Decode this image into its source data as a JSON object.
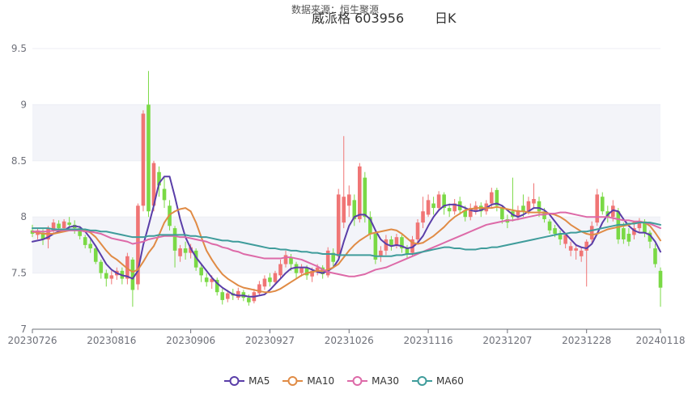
{
  "header": {
    "source": "数据来源：恒生聚源",
    "period": "日K"
  },
  "chart_data": {
    "type": "candlestick",
    "title": "威派格 603956",
    "ylim": [
      7,
      9.5
    ],
    "yticks": [
      7,
      7.5,
      8,
      8.5,
      9,
      9.5
    ],
    "xticks": [
      {
        "label": "20230726",
        "index": 0
      },
      {
        "label": "20230816",
        "index": 15
      },
      {
        "label": "20230906",
        "index": 30
      },
      {
        "label": "20230927",
        "index": 45
      },
      {
        "label": "20231026",
        "index": 60
      },
      {
        "label": "20231116",
        "index": 75
      },
      {
        "label": "20231207",
        "index": 90
      },
      {
        "label": "20231228",
        "index": 105
      },
      {
        "label": "20240118",
        "index": 119
      }
    ],
    "up_color": "#f07575",
    "down_color": "#7ad945",
    "open": [
      7.88,
      7.84,
      7.86,
      7.8,
      7.88,
      7.94,
      7.9,
      7.95,
      7.93,
      7.9,
      7.82,
      7.76,
      7.72,
      7.6,
      7.5,
      7.45,
      7.48,
      7.52,
      7.45,
      7.62,
      7.4,
      8.1,
      9.0,
      8.1,
      8.4,
      8.25,
      8.1,
      7.9,
      7.65,
      7.72,
      7.68,
      7.7,
      7.55,
      7.46,
      7.42,
      7.44,
      7.33,
      7.27,
      7.32,
      7.28,
      7.33,
      7.28,
      7.25,
      7.32,
      7.38,
      7.46,
      7.42,
      7.48,
      7.58,
      7.64,
      7.58,
      7.5,
      7.55,
      7.47,
      7.52,
      7.55,
      7.48,
      7.68,
      7.65,
      7.95,
      8.1,
      8.15,
      7.98,
      8.35,
      8.0,
      7.85,
      7.65,
      7.7,
      7.8,
      7.75,
      7.82,
      7.72,
      7.68,
      7.8,
      7.95,
      8.02,
      8.12,
      8.08,
      8.2,
      8.08,
      8.05,
      8.14,
      8.06,
      8.0,
      8.06,
      8.1,
      8.05,
      8.12,
      8.24,
      8.08,
      7.98,
      8.05,
      8.0,
      8.1,
      8.05,
      8.12,
      8.14,
      8.05,
      7.96,
      7.9,
      7.85,
      7.76,
      7.7,
      7.7,
      7.65,
      7.7,
      7.8,
      7.95,
      8.18,
      8.05,
      8.0,
      8.05,
      7.9,
      7.85,
      7.84,
      7.9,
      7.96,
      7.86,
      7.72,
      7.52
    ],
    "close": [
      7.85,
      7.88,
      7.8,
      7.9,
      7.95,
      7.9,
      7.96,
      7.93,
      7.9,
      7.83,
      7.75,
      7.72,
      7.6,
      7.5,
      7.45,
      7.48,
      7.52,
      7.45,
      7.65,
      7.35,
      8.1,
      8.92,
      8.05,
      8.48,
      8.28,
      8.15,
      7.92,
      7.7,
      7.72,
      7.68,
      7.73,
      7.55,
      7.48,
      7.42,
      7.45,
      7.33,
      7.26,
      7.32,
      7.3,
      7.34,
      7.28,
      7.24,
      7.33,
      7.4,
      7.45,
      7.42,
      7.5,
      7.58,
      7.66,
      7.58,
      7.5,
      7.55,
      7.48,
      7.52,
      7.55,
      7.49,
      7.7,
      7.6,
      8.2,
      8.18,
      8.2,
      7.98,
      8.45,
      8.0,
      7.85,
      7.62,
      7.7,
      7.8,
      7.75,
      7.82,
      7.72,
      7.67,
      7.8,
      7.95,
      8.05,
      8.15,
      8.08,
      8.2,
      8.08,
      8.05,
      8.12,
      8.06,
      8.0,
      8.08,
      8.1,
      8.05,
      8.12,
      8.22,
      8.1,
      7.98,
      7.95,
      8.0,
      8.06,
      8.05,
      8.14,
      8.16,
      8.05,
      7.98,
      7.88,
      7.85,
      7.8,
      7.84,
      7.74,
      7.72,
      7.7,
      7.78,
      7.92,
      8.2,
      8.05,
      8.0,
      8.1,
      7.8,
      7.8,
      7.78,
      7.9,
      7.96,
      7.86,
      7.78,
      7.58,
      7.37
    ],
    "low": [
      7.82,
      7.8,
      7.75,
      7.72,
      7.85,
      7.86,
      7.88,
      7.88,
      7.85,
      7.8,
      7.72,
      7.68,
      7.58,
      7.45,
      7.38,
      7.4,
      7.44,
      7.4,
      7.4,
      7.2,
      7.35,
      8.05,
      8.0,
      8.05,
      8.18,
      8.08,
      7.88,
      7.55,
      7.6,
      7.62,
      7.63,
      7.52,
      7.42,
      7.38,
      7.36,
      7.3,
      7.22,
      7.24,
      7.26,
      7.26,
      7.25,
      7.21,
      7.23,
      7.3,
      7.35,
      7.38,
      7.4,
      7.45,
      7.55,
      7.52,
      7.45,
      7.47,
      7.44,
      7.42,
      7.48,
      7.45,
      7.46,
      7.55,
      7.62,
      7.9,
      8.0,
      7.92,
      7.95,
      7.95,
      7.8,
      7.58,
      7.6,
      7.66,
      7.7,
      7.72,
      7.68,
      7.63,
      7.65,
      7.78,
      7.9,
      8.0,
      8.02,
      8.05,
      8.02,
      8.0,
      8.02,
      8.02,
      7.96,
      7.97,
      8.02,
      8.0,
      8.02,
      8.08,
      8.05,
      7.94,
      7.9,
      7.96,
      7.97,
      8.0,
      8.02,
      8.08,
      8.0,
      7.95,
      7.85,
      7.82,
      7.75,
      7.72,
      7.65,
      7.62,
      7.6,
      7.38,
      7.76,
      7.92,
      8.02,
      7.95,
      7.96,
      7.76,
      7.76,
      7.74,
      7.8,
      7.86,
      7.82,
      7.72,
      7.55,
      7.2
    ],
    "high": [
      7.93,
      7.9,
      7.89,
      7.92,
      7.98,
      7.97,
      7.98,
      8.0,
      7.97,
      7.92,
      7.84,
      7.8,
      7.75,
      7.62,
      7.53,
      7.52,
      7.55,
      7.55,
      7.68,
      7.64,
      8.12,
      8.95,
      9.3,
      8.5,
      8.45,
      8.35,
      8.15,
      7.92,
      7.75,
      7.78,
      7.76,
      7.72,
      7.58,
      7.5,
      7.48,
      7.46,
      7.36,
      7.35,
      7.36,
      7.37,
      7.35,
      7.31,
      7.36,
      7.43,
      7.48,
      7.5,
      7.52,
      7.62,
      7.7,
      7.67,
      7.6,
      7.58,
      7.57,
      7.55,
      7.58,
      7.57,
      7.73,
      7.72,
      8.25,
      8.72,
      8.28,
      8.2,
      8.48,
      8.4,
      8.05,
      7.88,
      7.74,
      7.84,
      7.83,
      7.85,
      7.84,
      7.75,
      7.83,
      7.98,
      8.18,
      8.2,
      8.18,
      8.23,
      8.22,
      8.12,
      8.16,
      8.18,
      8.1,
      8.12,
      8.14,
      8.13,
      8.15,
      8.26,
      8.26,
      8.1,
      8.02,
      8.35,
      8.1,
      8.2,
      8.18,
      8.3,
      8.18,
      8.08,
      7.98,
      7.93,
      7.88,
      7.86,
      7.78,
      7.76,
      7.73,
      7.8,
      7.96,
      8.25,
      8.22,
      8.1,
      8.15,
      8.08,
      7.95,
      7.9,
      7.94,
      7.99,
      7.98,
      7.88,
      7.76,
      7.55
    ],
    "series": [
      {
        "name": "MA5",
        "color": "#5a3ea8",
        "values": [
          7.78,
          7.79,
          7.8,
          7.82,
          7.85,
          7.87,
          7.88,
          7.91,
          7.92,
          7.91,
          7.87,
          7.81,
          7.74,
          7.66,
          7.58,
          7.53,
          7.5,
          7.48,
          7.47,
          7.45,
          7.52,
          7.75,
          7.92,
          8.1,
          8.3,
          8.36,
          8.36,
          8.18,
          7.98,
          7.82,
          7.72,
          7.64,
          7.58,
          7.52,
          7.46,
          7.41,
          7.37,
          7.34,
          7.31,
          7.3,
          7.3,
          7.29,
          7.29,
          7.3,
          7.31,
          7.35,
          7.4,
          7.45,
          7.5,
          7.54,
          7.55,
          7.55,
          7.55,
          7.53,
          7.51,
          7.5,
          7.52,
          7.55,
          7.62,
          7.78,
          7.92,
          8.0,
          8.02,
          8.02,
          7.98,
          7.88,
          7.8,
          7.76,
          7.74,
          7.75,
          7.74,
          7.72,
          7.73,
          7.77,
          7.83,
          7.92,
          8.0,
          8.06,
          8.1,
          8.11,
          8.11,
          8.1,
          8.08,
          8.06,
          8.05,
          8.06,
          8.08,
          8.11,
          8.12,
          8.1,
          8.06,
          8.02,
          8.0,
          8.02,
          8.05,
          8.08,
          8.08,
          8.06,
          8.02,
          7.96,
          7.9,
          7.85,
          7.8,
          7.75,
          7.73,
          7.72,
          7.76,
          7.85,
          7.95,
          8.02,
          8.06,
          8.05,
          7.98,
          7.92,
          7.88,
          7.86,
          7.86,
          7.84,
          7.78,
          7.69
        ]
      },
      {
        "name": "MA10",
        "color": "#e08b45",
        "values": [
          7.87,
          7.86,
          7.85,
          7.85,
          7.85,
          7.86,
          7.87,
          7.88,
          7.89,
          7.89,
          7.88,
          7.86,
          7.82,
          7.76,
          7.7,
          7.65,
          7.62,
          7.58,
          7.54,
          7.51,
          7.53,
          7.6,
          7.68,
          7.74,
          7.84,
          7.95,
          8.02,
          8.05,
          8.07,
          8.08,
          8.05,
          7.95,
          7.82,
          7.7,
          7.62,
          7.55,
          7.49,
          7.45,
          7.42,
          7.39,
          7.37,
          7.36,
          7.35,
          7.34,
          7.33,
          7.33,
          7.34,
          7.36,
          7.39,
          7.42,
          7.45,
          7.48,
          7.5,
          7.51,
          7.52,
          7.52,
          7.53,
          7.55,
          7.58,
          7.64,
          7.7,
          7.75,
          7.79,
          7.82,
          7.85,
          7.86,
          7.87,
          7.88,
          7.89,
          7.88,
          7.85,
          7.81,
          7.77,
          7.76,
          7.77,
          7.8,
          7.83,
          7.87,
          7.91,
          7.96,
          8.0,
          8.03,
          8.06,
          8.07,
          8.08,
          8.08,
          8.08,
          8.08,
          8.09,
          8.08,
          8.07,
          8.06,
          8.05,
          8.05,
          8.04,
          8.04,
          8.04,
          8.04,
          8.03,
          8.02,
          8.0,
          7.97,
          7.93,
          7.9,
          7.87,
          7.85,
          7.84,
          7.85,
          7.87,
          7.89,
          7.9,
          7.91,
          7.92,
          7.93,
          7.95,
          7.96,
          7.95,
          7.92,
          7.86,
          7.79
        ]
      },
      {
        "name": "MA30",
        "color": "#dd6aa8",
        "values": [
          7.87,
          7.87,
          7.87,
          7.87,
          7.88,
          7.88,
          7.88,
          7.88,
          7.88,
          7.88,
          7.87,
          7.87,
          7.86,
          7.85,
          7.83,
          7.81,
          7.8,
          7.79,
          7.78,
          7.76,
          7.77,
          7.78,
          7.8,
          7.81,
          7.82,
          7.83,
          7.83,
          7.83,
          7.82,
          7.82,
          7.81,
          7.8,
          7.79,
          7.78,
          7.76,
          7.75,
          7.73,
          7.72,
          7.7,
          7.69,
          7.67,
          7.66,
          7.65,
          7.64,
          7.63,
          7.63,
          7.63,
          7.63,
          7.64,
          7.64,
          7.63,
          7.62,
          7.6,
          7.58,
          7.56,
          7.53,
          7.51,
          7.5,
          7.49,
          7.48,
          7.47,
          7.47,
          7.48,
          7.49,
          7.51,
          7.53,
          7.54,
          7.55,
          7.57,
          7.59,
          7.61,
          7.63,
          7.65,
          7.67,
          7.69,
          7.71,
          7.73,
          7.75,
          7.77,
          7.79,
          7.81,
          7.83,
          7.85,
          7.87,
          7.89,
          7.91,
          7.93,
          7.94,
          7.95,
          7.96,
          7.97,
          7.97,
          7.98,
          7.99,
          8.0,
          8.01,
          8.02,
          8.02,
          8.03,
          8.03,
          8.04,
          8.04,
          8.03,
          8.02,
          8.01,
          8.0,
          8.0,
          8.0,
          8.0,
          8.0,
          7.99,
          7.98,
          7.97,
          7.97,
          7.96,
          7.96,
          7.95,
          7.94,
          7.92,
          7.9
        ]
      },
      {
        "name": "MA60",
        "color": "#3f9c9b",
        "values": [
          7.9,
          7.9,
          7.9,
          7.9,
          7.89,
          7.89,
          7.89,
          7.89,
          7.89,
          7.89,
          7.89,
          7.88,
          7.88,
          7.87,
          7.87,
          7.86,
          7.85,
          7.84,
          7.83,
          7.82,
          7.82,
          7.82,
          7.83,
          7.83,
          7.84,
          7.84,
          7.84,
          7.84,
          7.84,
          7.84,
          7.83,
          7.83,
          7.82,
          7.82,
          7.81,
          7.8,
          7.79,
          7.79,
          7.78,
          7.78,
          7.77,
          7.76,
          7.75,
          7.74,
          7.73,
          7.72,
          7.72,
          7.71,
          7.71,
          7.7,
          7.7,
          7.69,
          7.69,
          7.68,
          7.68,
          7.67,
          7.67,
          7.67,
          7.66,
          7.66,
          7.66,
          7.66,
          7.66,
          7.66,
          7.66,
          7.65,
          7.65,
          7.65,
          7.65,
          7.66,
          7.66,
          7.67,
          7.67,
          7.68,
          7.69,
          7.7,
          7.71,
          7.72,
          7.73,
          7.73,
          7.72,
          7.72,
          7.71,
          7.71,
          7.71,
          7.72,
          7.72,
          7.73,
          7.73,
          7.74,
          7.75,
          7.76,
          7.77,
          7.78,
          7.79,
          7.8,
          7.81,
          7.82,
          7.83,
          7.84,
          7.85,
          7.85,
          7.86,
          7.86,
          7.87,
          7.87,
          7.88,
          7.89,
          7.9,
          7.91,
          7.92,
          7.93,
          7.93,
          7.94,
          7.94,
          7.95,
          7.95,
          7.95,
          7.94,
          7.93
        ]
      }
    ],
    "legend_position": "bottom"
  }
}
